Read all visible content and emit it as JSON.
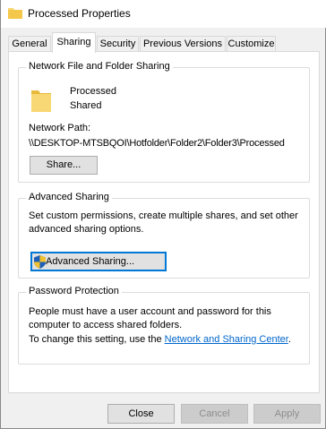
{
  "window": {
    "title": "Processed Properties"
  },
  "tabs": [
    {
      "label": "General"
    },
    {
      "label": "Sharing"
    },
    {
      "label": "Security"
    },
    {
      "label": "Previous Versions"
    },
    {
      "label": "Customize"
    }
  ],
  "network_sharing": {
    "group_title": "Network File and Folder Sharing",
    "folder_name": "Processed",
    "folder_state": "Shared",
    "network_path_label": "Network Path:",
    "network_path": "\\\\DESKTOP-MTSBQOI\\Hotfolder\\Folder2\\Folder3\\Processed",
    "share_button": "Share..."
  },
  "advanced_sharing": {
    "group_title": "Advanced Sharing",
    "description": "Set custom permissions, create multiple shares, and set other advanced sharing options.",
    "button": "Advanced Sharing..."
  },
  "password_protection": {
    "group_title": "Password Protection",
    "description": "People must have a user account and password for this computer to access shared folders.",
    "change_text": "To change this setting, use the ",
    "link": "Network and Sharing Center",
    "end_text": "."
  },
  "footer": {
    "close": "Close",
    "cancel": "Cancel",
    "apply": "Apply"
  },
  "colors": {
    "folder": "#f8d775",
    "link": "#0066cc",
    "focus": "#0078d7"
  },
  "icons": {
    "title": "folder-icon",
    "folder": "folder-icon",
    "advanced_button": "uac-shield-icon"
  }
}
